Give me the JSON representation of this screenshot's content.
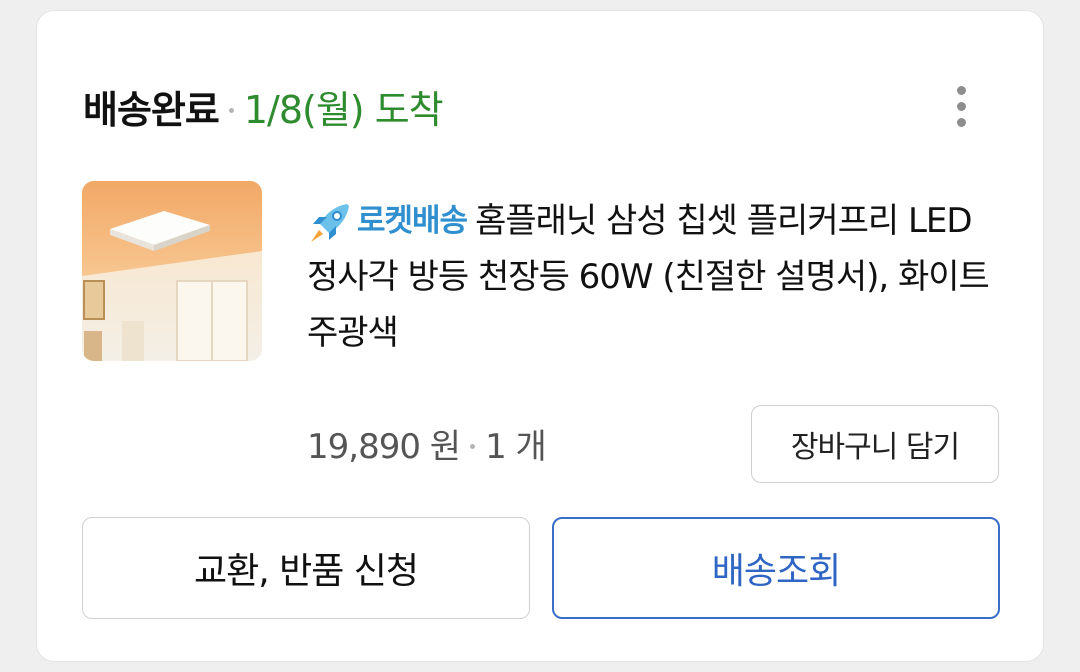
{
  "order": {
    "status": "배송완료",
    "arrival": "1/8(월) 도착"
  },
  "product": {
    "badge_label": "로켓배송",
    "badge_icon": "rocket-icon",
    "name": "홈플래닛 삼성 칩셋 플리커프리 LED 정사각 방등 천장등 60W (친절한 설명서), 화이트 주광색",
    "price": "19,890 원",
    "quantity": "1 개"
  },
  "actions": {
    "add_to_cart": "장바구니 담기",
    "return_exchange": "교환, 반품 신청",
    "track_delivery": "배송조회"
  },
  "colors": {
    "arrival_green": "#2e8b2e",
    "rocket_blue": "#2f8fcf",
    "track_blue": "#3a6fc8"
  }
}
